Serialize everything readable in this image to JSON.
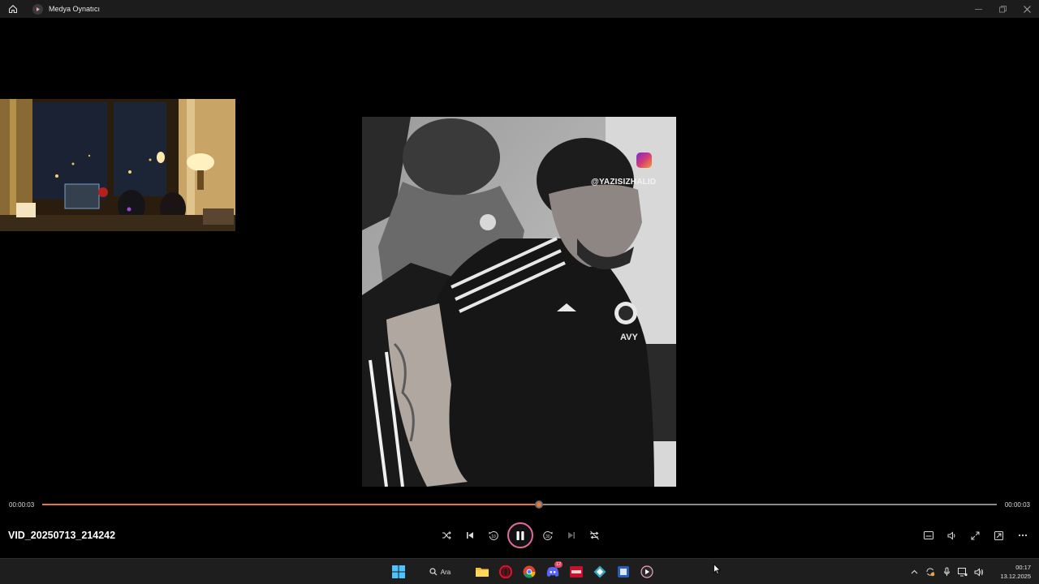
{
  "window": {
    "title": "Medya Oynatıcı",
    "icons": [
      "home-icon",
      "media-player-app-icon"
    ],
    "controls": [
      "minimize",
      "maximize",
      "close"
    ]
  },
  "video": {
    "watermark_text": "@YAZISIZHALID",
    "watermark_icon": "instagram-icon"
  },
  "playback": {
    "current_time": "00:00:03",
    "total_time": "00:00:03",
    "progress": 0.52,
    "accent_color": "#e8773a"
  },
  "controls": {
    "filename": "VID_20250713_214242",
    "buttons": [
      "shuffle",
      "previous",
      "rewind-10",
      "pause",
      "forward-30",
      "next",
      "repeat-off"
    ],
    "rewind_label": "10",
    "forward_label": "30",
    "right_buttons": [
      "subtitles",
      "volume",
      "fullscreen",
      "mini-player",
      "more"
    ]
  },
  "taskbar": {
    "search_label": "Ara",
    "discord_badge": "12",
    "pinned": [
      "start",
      "search",
      "file-explorer",
      "opera",
      "chrome",
      "discord",
      "app-red",
      "app-teal",
      "app-blue",
      "media-player"
    ],
    "clock_time": "00:17",
    "clock_date": "13.12.2025"
  }
}
